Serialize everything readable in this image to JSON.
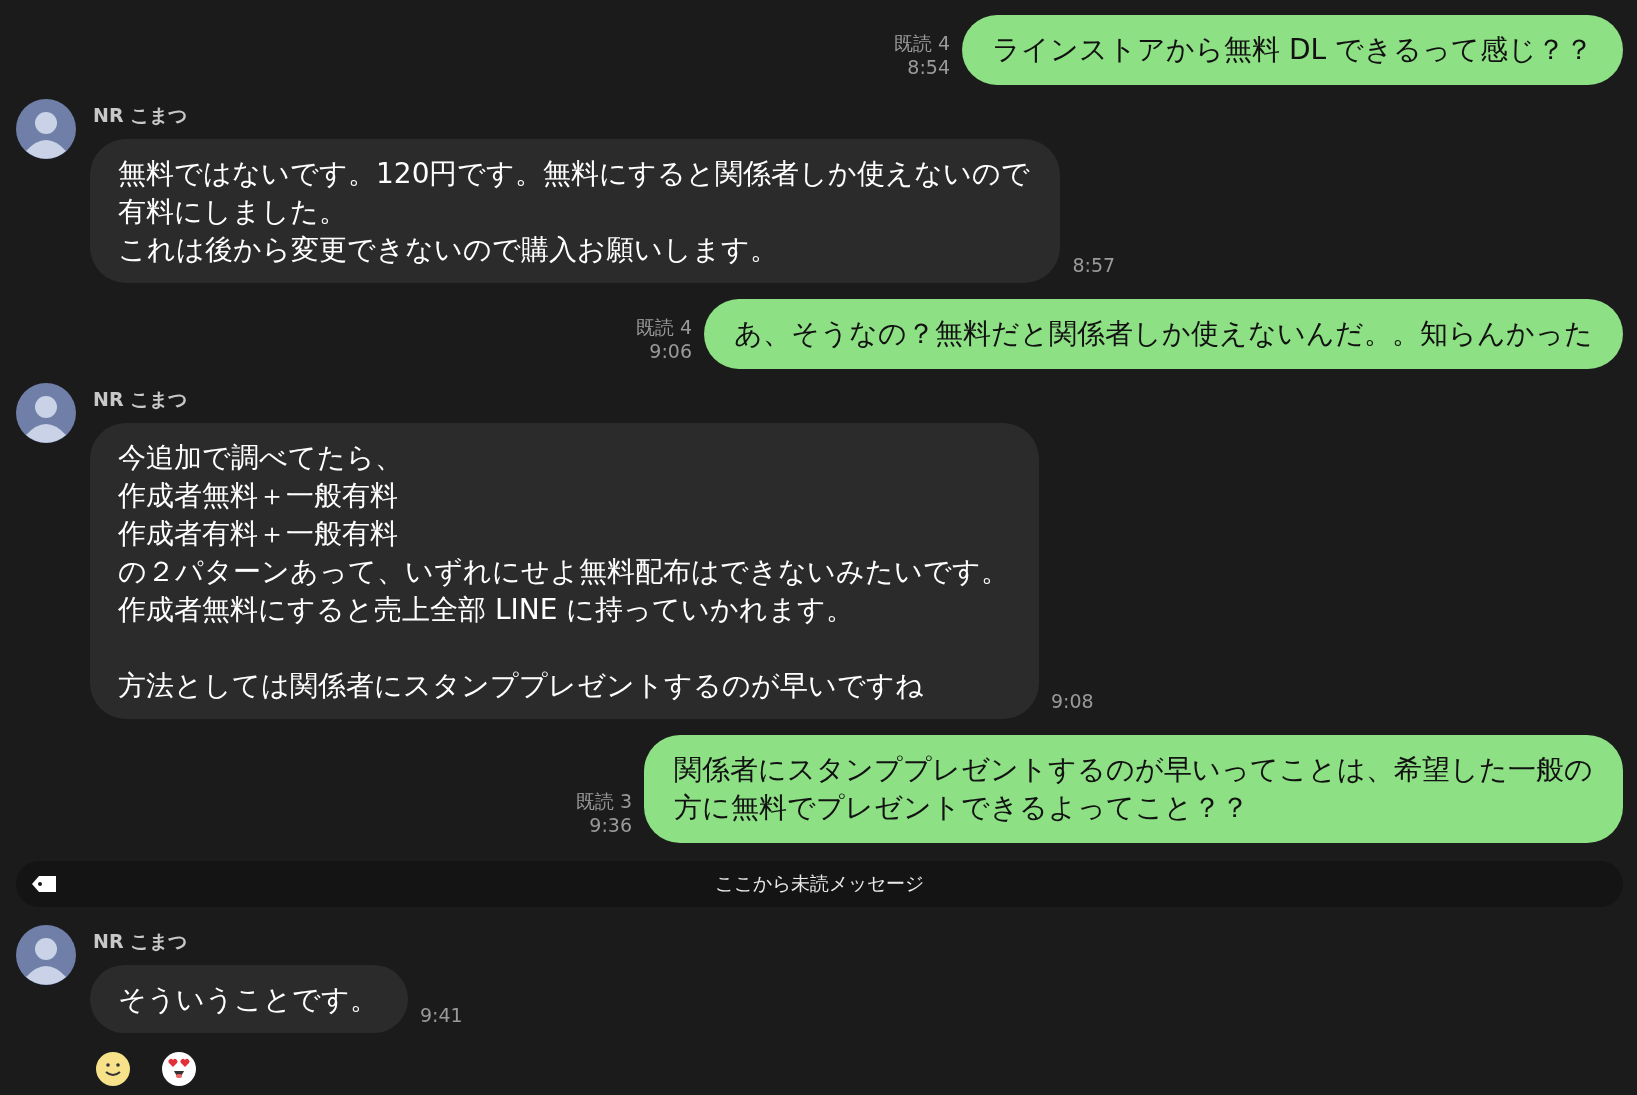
{
  "messages": [
    {
      "kind": "sent",
      "paragraphs": [
        [
          "ラインストアから無料 DL できるって感じ？？"
        ]
      ],
      "read": "既読 4",
      "time": "8:54"
    },
    {
      "kind": "received",
      "sender": "NR こまつ",
      "paragraphs": [
        [
          "無料ではないです。120円です。無料にすると関係者しか使えないので",
          "有料にしました。",
          "これは後から変更できないので購入お願いします。"
        ]
      ],
      "time": "8:57"
    },
    {
      "kind": "sent",
      "paragraphs": [
        [
          "あ、そうなの？無料だと関係者しか使えないんだ。。知らんかった"
        ]
      ],
      "read": "既読 4",
      "time": "9:06"
    },
    {
      "kind": "received",
      "sender": "NR こまつ",
      "paragraphs": [
        [
          "今追加で調べてたら、",
          "作成者無料＋一般有料",
          "作成者有料＋一般有料",
          "の２パターンあって、いずれにせよ無料配布はできないみたいです。",
          "作成者無料にすると売上全部 LINE に持っていかれます。"
        ],
        [
          "方法としては関係者にスタンププレゼントするのが早いですね"
        ]
      ],
      "time": "9:08"
    },
    {
      "kind": "sent",
      "paragraphs": [
        [
          "関係者にスタンププレゼントするのが早いってことは、希望した一般の",
          "方に無料でプレゼントできるよってこと？？"
        ]
      ],
      "read": "既読 3",
      "time": "9:36"
    },
    {
      "kind": "divider",
      "text": "ここから未読メッセージ"
    },
    {
      "kind": "received",
      "sender": "NR こまつ",
      "paragraphs": [
        [
          "そういうことです。"
        ]
      ],
      "time": "9:41",
      "reactions": [
        {
          "kind": "smile"
        },
        {
          "kind": "heart-eyes"
        }
      ]
    }
  ]
}
